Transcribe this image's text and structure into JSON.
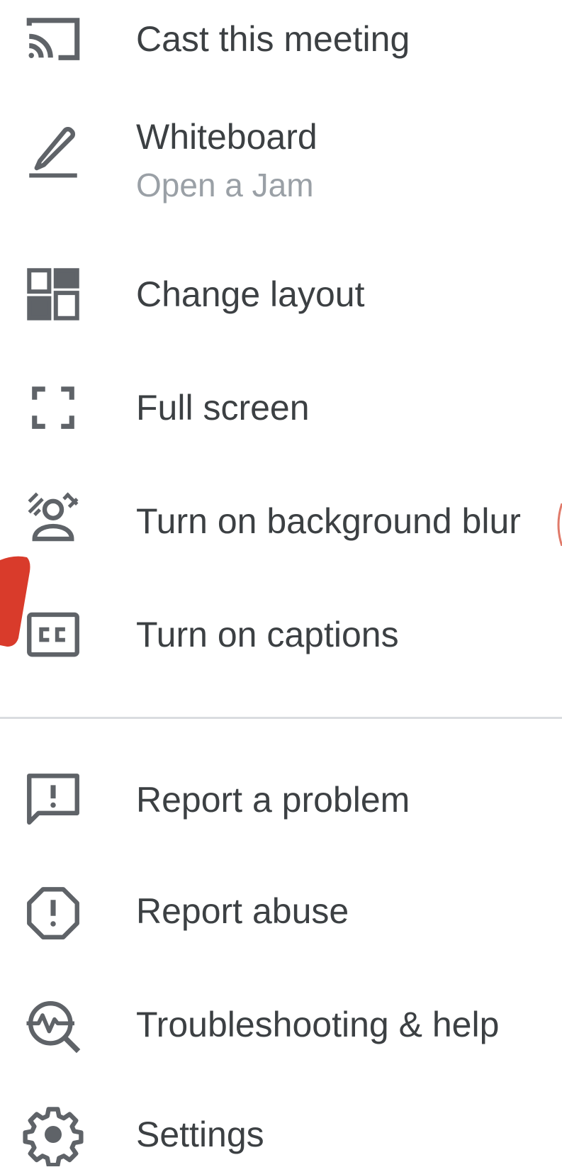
{
  "menu": {
    "items": [
      {
        "label": "Cast this meeting",
        "icon": "cast-icon"
      },
      {
        "label": "Whiteboard",
        "sublabel": "Open a Jam",
        "icon": "pencil-icon"
      },
      {
        "label": "Change layout",
        "icon": "layout-icon"
      },
      {
        "label": "Full screen",
        "icon": "fullscreen-icon"
      },
      {
        "label": "Turn on background blur",
        "icon": "background-blur-icon"
      },
      {
        "label": "Turn on captions",
        "icon": "captions-icon"
      }
    ],
    "secondary_items": [
      {
        "label": "Report a problem",
        "icon": "feedback-icon"
      },
      {
        "label": "Report abuse",
        "icon": "report-abuse-icon"
      },
      {
        "label": "Troubleshooting & help",
        "icon": "troubleshooting-icon"
      },
      {
        "label": "Settings",
        "icon": "gear-icon"
      }
    ]
  },
  "colors": {
    "text": "#3c4043",
    "secondary_text": "#9aa0a6",
    "icon": "#5f6368",
    "divider": "#dadce0",
    "annotation": "#d93b2b"
  }
}
